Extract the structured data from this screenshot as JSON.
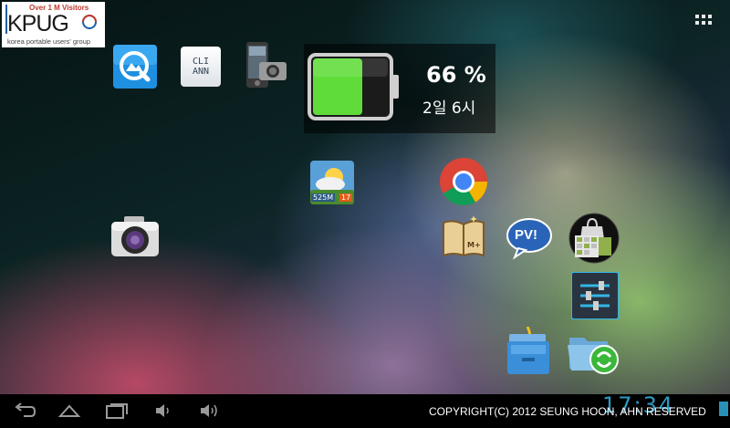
{
  "logo": {
    "tagline": "Over 1 M Visitors",
    "name": "KPUG",
    "subtitle": "korea portable users' group"
  },
  "app_drawer": {
    "icon": "app-grid-icon"
  },
  "apps": [
    {
      "name": "quickpic",
      "icon": "quickpic-icon"
    },
    {
      "name": "clinn",
      "icon": "clinn-icon",
      "label": "CLI ANN"
    },
    {
      "name": "phone-camera",
      "icon": "phone-camera-icon"
    },
    {
      "name": "weather",
      "icon": "weather-icon",
      "badge_left": "525M",
      "badge_right": "17"
    },
    {
      "name": "chrome",
      "icon": "chrome-icon"
    },
    {
      "name": "camera",
      "icon": "camera-icon"
    },
    {
      "name": "book-reader",
      "icon": "book-icon",
      "label": "M+"
    },
    {
      "name": "pv",
      "icon": "pv-icon",
      "label": "PV!"
    },
    {
      "name": "market-calendar",
      "icon": "market-calendar-icon"
    },
    {
      "name": "settings",
      "icon": "settings-icon"
    },
    {
      "name": "file-manager",
      "icon": "file-manager-icon"
    },
    {
      "name": "file-expert",
      "icon": "folder-sync-icon"
    }
  ],
  "battery_widget": {
    "percent": "66 %",
    "time_left": "2일 6시",
    "level": 0.66,
    "color": "#5fdc3a"
  },
  "navbar": {
    "buttons": [
      "back-icon",
      "home-icon",
      "recent-apps-icon",
      "volume-down-icon",
      "volume-up-icon"
    ],
    "copyright": "COPYRIGHT(C) 2012 SEUNG HOON, AHN RESERVED",
    "clock": "17:34",
    "accent": "#33b5e5"
  }
}
